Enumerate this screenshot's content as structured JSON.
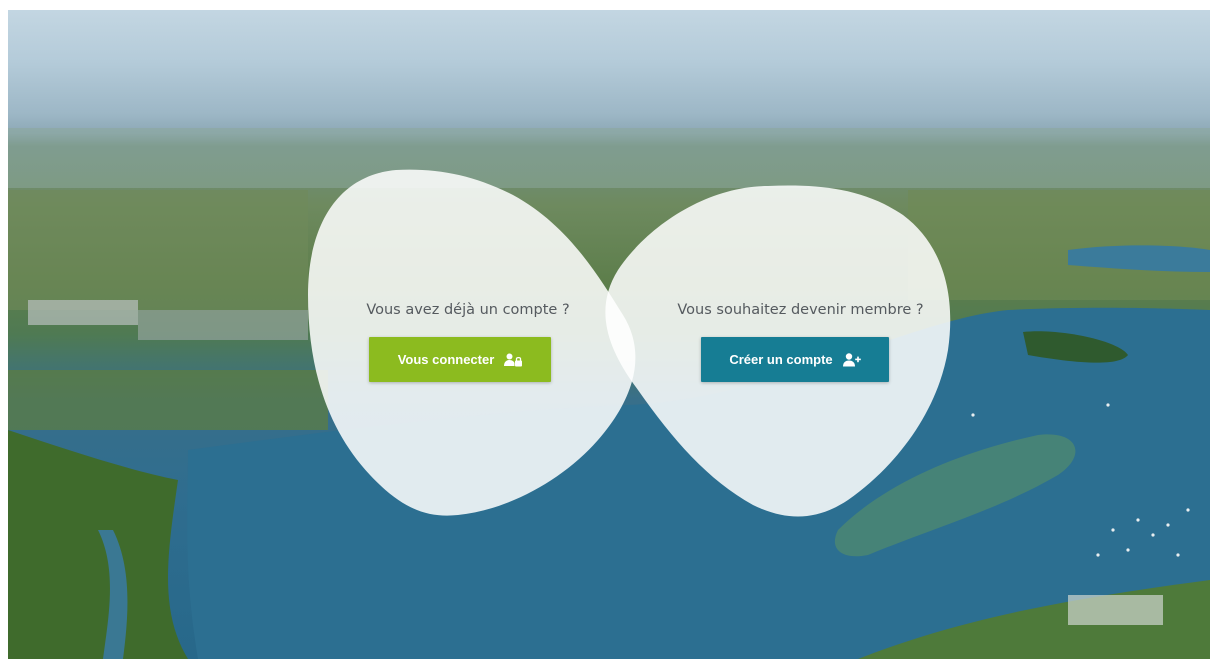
{
  "login": {
    "question": "Vous avez déjà un compte ?",
    "button_label": "Vous connecter",
    "icon": "users-lock-icon",
    "color": "#8cbb1f"
  },
  "signup": {
    "question": "Vous souhaitez devenir membre ?",
    "button_label": "Créer un compte",
    "icon": "user-plus-icon",
    "color": "#167d94"
  },
  "background": {
    "image": "aerial-landscape-lake"
  }
}
